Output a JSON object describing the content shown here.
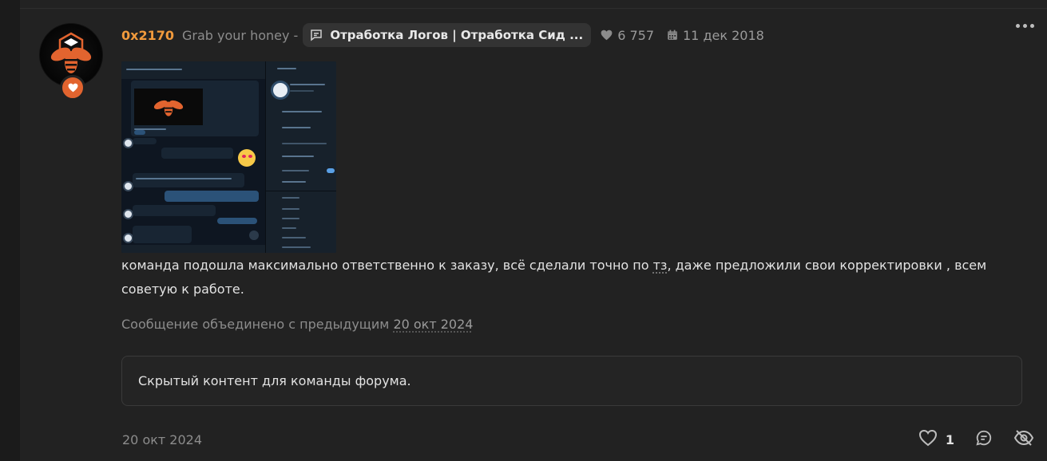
{
  "post": {
    "author": "0x2170",
    "thread_prefix": "Grab your honey -",
    "thread_title": "Отработка Логов | Отработка Сид ...",
    "views": "6 757",
    "thread_date": "11 дек 2018",
    "body": {
      "before": "команда подошла максимально ответственно к заказу, всё сделали точно по ",
      "abbr": "тз",
      "after": ", даже предложили свои корректировки , всем советую к работе."
    },
    "merged_text": "Сообщение объединено с предыдущим",
    "merged_date": "20 окт 2024",
    "hidden_content": "Скрытый контент для команды форума.",
    "post_date": "20 окт 2024",
    "likes": "1"
  },
  "colors": {
    "username": "#f19a3c",
    "badge": "#e2642f",
    "background": "#222222"
  },
  "icons": [
    "heart-icon",
    "calendar-icon",
    "message-icon",
    "more-icon",
    "reply-icon",
    "hide-icon"
  ]
}
